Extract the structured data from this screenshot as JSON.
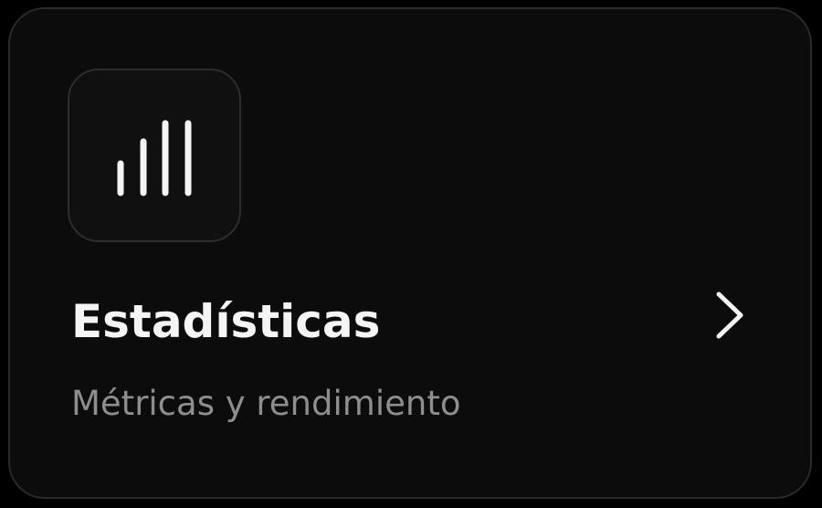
{
  "card": {
    "title": "Estadísticas",
    "subtitle": "Métricas y rendimiento",
    "icon": "bar-signal-icon",
    "trailing_icon": "chevron-right-icon"
  },
  "colors": {
    "background": "#000000",
    "card": "#0c0c0c",
    "border": "#2a2a2a",
    "title": "#f5f5f5",
    "subtitle": "#8e8e8e",
    "icon": "#f5f5f5"
  }
}
